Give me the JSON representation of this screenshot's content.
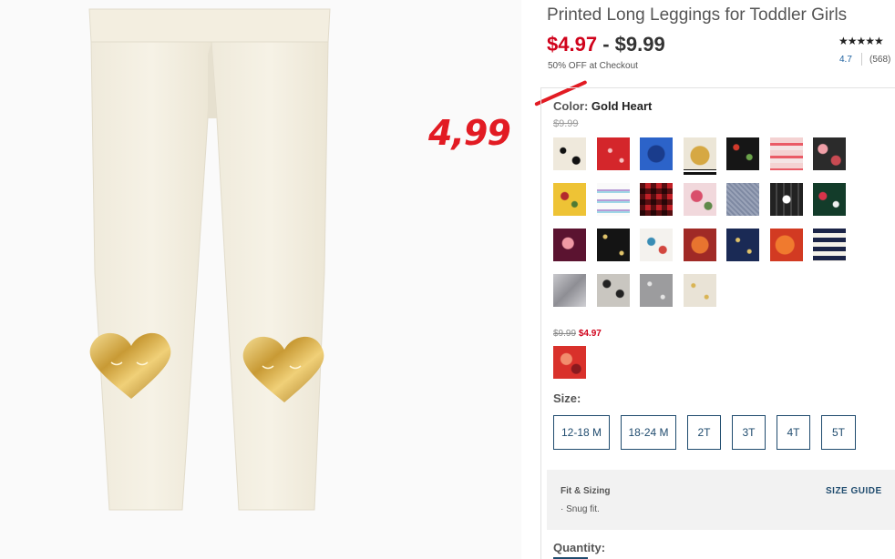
{
  "annotation": {
    "handwritten_price": "4,99"
  },
  "product": {
    "title": "Printed Long Leggings for Toddler Girls",
    "price_sale": "$4.97",
    "price_separator": "-",
    "price_regular": "$9.99",
    "promo": "50% OFF at Checkout"
  },
  "rating": {
    "stars": "★★★★★",
    "value": "4.7",
    "count": "(568)"
  },
  "color": {
    "label": "Color:",
    "selected_name": "Gold Heart",
    "old_price": "$9.99",
    "swatches": [
      "stars-cream",
      "red-snowflake",
      "blue-star",
      "gold-heart",
      "black-floral",
      "red-stripe",
      "dark-floral",
      "yellow-floral",
      "lavender-stripe",
      "red-buffalo-check",
      "pink-floral",
      "grey-heather",
      "black-fairisle",
      "green-floral",
      "burgundy-floral",
      "black-dot",
      "white-floral",
      "orange-floral",
      "navy-dot",
      "orange-leaf",
      "navy-stripe",
      "silver-metallic",
      "leopard",
      "grey-dot",
      "cream-gold-dot"
    ]
  },
  "sale": {
    "old": "$9.99",
    "new": "$4.97",
    "swatches": [
      "red-floral"
    ]
  },
  "size": {
    "label": "Size:",
    "options": [
      "12-18 M",
      "18-24 M",
      "2T",
      "3T",
      "4T",
      "5T"
    ]
  },
  "fit": {
    "title": "Fit & Sizing",
    "item": "Snug fit.",
    "bullet": "·",
    "size_guide": "SIZE GUIDE"
  },
  "quantity": {
    "label": "Quantity:"
  },
  "colors": {
    "sale_red": "#d0021b",
    "accent_navy": "#1f4b6e",
    "annotation_red": "#e21b23"
  }
}
